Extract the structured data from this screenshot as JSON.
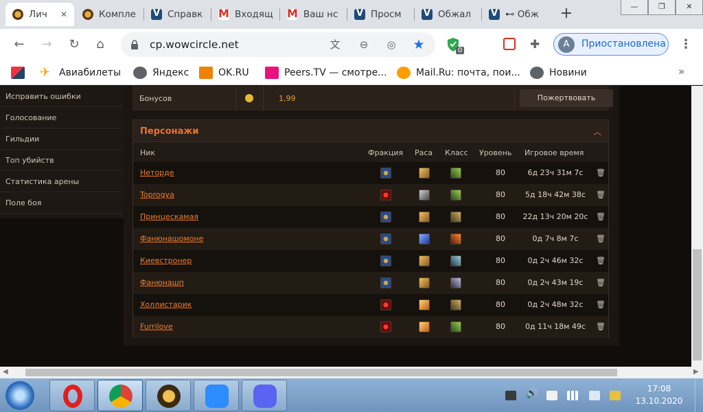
{
  "tabs": [
    {
      "title": "Лич",
      "icon": "wow-icon",
      "active": true
    },
    {
      "title": "Компле",
      "icon": "wow-icon"
    },
    {
      "title": "Справк",
      "icon": "wowcircle-icon"
    },
    {
      "title": "Входящ",
      "icon": "gmail-icon"
    },
    {
      "title": "Ваш нс",
      "icon": "gmail-icon"
    },
    {
      "title": "Просм",
      "icon": "wowcircle-icon"
    },
    {
      "title": "Обжал",
      "icon": "wowcircle-icon"
    },
    {
      "title": "⊷ Обж",
      "icon": "wowcircle-icon"
    }
  ],
  "address": {
    "url": "cp.wowcircle.net"
  },
  "extension_badge": "0",
  "profile": {
    "initial": "A",
    "label": "Приостановлена"
  },
  "bookmarks": [
    {
      "label": "",
      "icon": "mk-icon"
    },
    {
      "label": "Авиабилеты",
      "icon": "plane-icon"
    },
    {
      "label": "Яндекс",
      "icon": "globe-icon"
    },
    {
      "label": "OK.RU",
      "icon": "ok-icon"
    },
    {
      "label": "Peers.TV — смотре...",
      "icon": "tv-icon"
    },
    {
      "label": "Mail.Ru: почта, пои...",
      "icon": "mail-at-icon"
    },
    {
      "label": "Новини",
      "icon": "globe-icon"
    }
  ],
  "sidebar": [
    "Исправить ошибки",
    "Голосование",
    "Гильдии",
    "Топ убийств",
    "Статистика арены",
    "Поле боя"
  ],
  "bonus": {
    "label": "Бонусов",
    "value": "1,99",
    "button": "Пожертвовать"
  },
  "characters": {
    "title": "Персонажи",
    "columns": [
      "Ник",
      "Фракция",
      "Раса",
      "Класс",
      "Уровень",
      "Игровое время"
    ],
    "rows": [
      {
        "nick": "Неторде",
        "faction": "alliance",
        "level": "80",
        "time": "6д 23ч 31м 7с"
      },
      {
        "nick": "Toprogya",
        "faction": "horde",
        "level": "80",
        "time": "5д 18ч 42м 38с"
      },
      {
        "nick": "Принцескамая",
        "faction": "alliance",
        "level": "80",
        "time": "22д 13ч 20м 20с"
      },
      {
        "nick": "Фанюнашомоне",
        "faction": "alliance",
        "level": "80",
        "time": "0д 7ч 8м 7с"
      },
      {
        "nick": "Киевстронер",
        "faction": "alliance",
        "level": "80",
        "time": "0д 2ч 46м 32с"
      },
      {
        "nick": "Фанюнашп",
        "faction": "alliance",
        "level": "80",
        "time": "0д 2ч 43м 19с"
      },
      {
        "nick": "Холлистарик",
        "faction": "horde",
        "level": "80",
        "time": "0д 2ч 48м 32с"
      },
      {
        "nick": "Furrilove",
        "faction": "horde",
        "level": "80",
        "time": "0д 11ч 18м 49с"
      }
    ]
  },
  "taskbar": {
    "time": "17:08",
    "date": "13.10.2020"
  }
}
